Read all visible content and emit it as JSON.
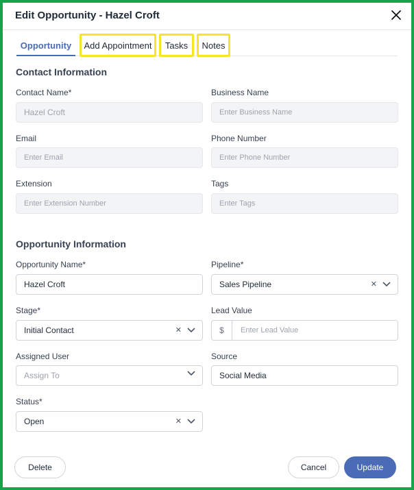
{
  "modal": {
    "title": "Edit Opportunity - Hazel Croft",
    "close_icon": "close-icon"
  },
  "tabs": [
    {
      "label": "Opportunity",
      "active": true
    },
    {
      "label": "Add Appointment"
    },
    {
      "label": "Tasks"
    },
    {
      "label": "Notes"
    }
  ],
  "contact": {
    "section_title": "Contact Information",
    "contact_name": {
      "label": "Contact Name*",
      "value": "Hazel Croft"
    },
    "business_name": {
      "label": "Business Name",
      "placeholder": "Enter Business Name"
    },
    "email": {
      "label": "Email",
      "placeholder": "Enter Email"
    },
    "phone": {
      "label": "Phone Number",
      "placeholder": "Enter Phone Number"
    },
    "extension": {
      "label": "Extension",
      "placeholder": "Enter Extension Number"
    },
    "tags": {
      "label": "Tags",
      "placeholder": "Enter Tags"
    }
  },
  "opportunity": {
    "section_title": "Opportunity Information",
    "name": {
      "label": "Opportunity Name*",
      "value": "Hazel Croft"
    },
    "pipeline": {
      "label": "Pipeline*",
      "value": "Sales Pipeline"
    },
    "stage": {
      "label": "Stage*",
      "value": "Initial Contact"
    },
    "lead_value": {
      "label": "Lead Value",
      "prefix": "$",
      "placeholder": "Enter Lead Value"
    },
    "assigned_user": {
      "label": "Assigned User",
      "placeholder": "Assign To"
    },
    "source": {
      "label": "Source",
      "value": "Social Media"
    },
    "status": {
      "label": "Status*",
      "value": "Open"
    }
  },
  "footer": {
    "delete_label": "Delete",
    "cancel_label": "Cancel",
    "update_label": "Update"
  },
  "colors": {
    "frame_border": "#16a34a",
    "highlight": "#f5e62b",
    "accent": "#4a6bb5"
  }
}
